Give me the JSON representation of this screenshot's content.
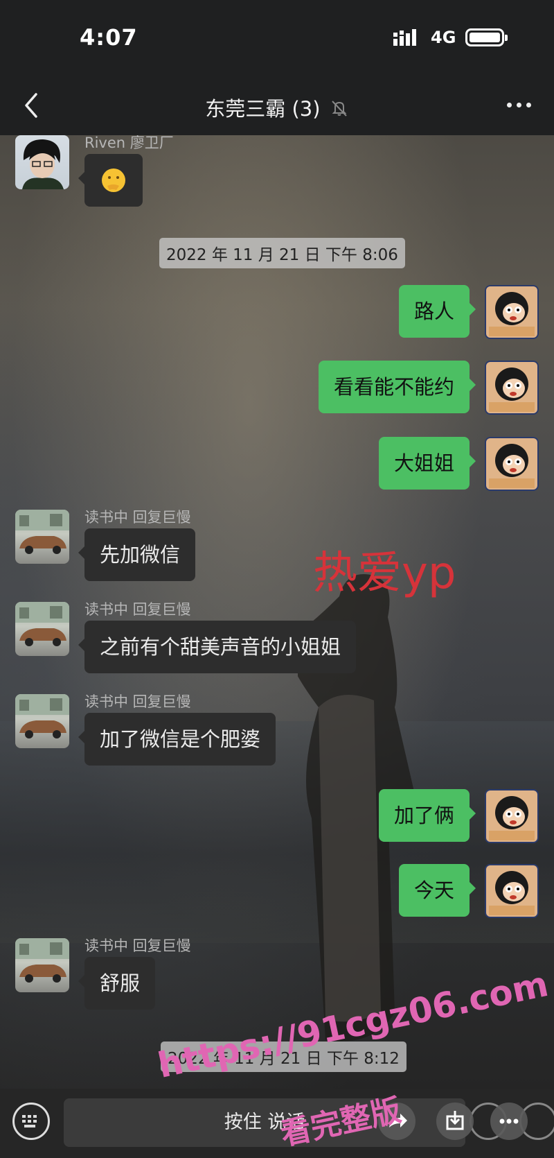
{
  "status_bar": {
    "time": "4:07",
    "network": "4G"
  },
  "nav": {
    "title": "东莞三霸 (3)"
  },
  "messages": [
    {
      "sender": "Riven 廖卫厂",
      "text": ""
    },
    {
      "timestamp": "2022 年 11 月 21 日 下午 8:06"
    },
    {
      "text": "路人"
    },
    {
      "text": "看看能不能约"
    },
    {
      "text": "大姐姐"
    },
    {
      "sender": "读书中 回复巨慢",
      "text": "先加微信"
    },
    {
      "sender": "读书中 回复巨慢",
      "text": "之前有个甜美声音的小姐姐"
    },
    {
      "sender": "读书中 回复巨慢",
      "text": "加了微信是个肥婆"
    },
    {
      "text": "加了俩"
    },
    {
      "text": "今天"
    },
    {
      "sender": "读书中 回复巨慢",
      "text": "舒服"
    },
    {
      "timestamp": "2022 年 11 月 21 日 下午 8:12"
    }
  ],
  "overlay_text": "热爱yp",
  "watermark": {
    "line1": "https://91cgz06.com",
    "line2": "看完整版"
  },
  "input_bar": {
    "talk_label": "按住 说话"
  },
  "colors": {
    "outgoing_bubble": "#4cbf63",
    "incoming_bubble": "#2d2d2d",
    "overlay_red": "#d6333a",
    "watermark_pink": "#e066b3"
  }
}
